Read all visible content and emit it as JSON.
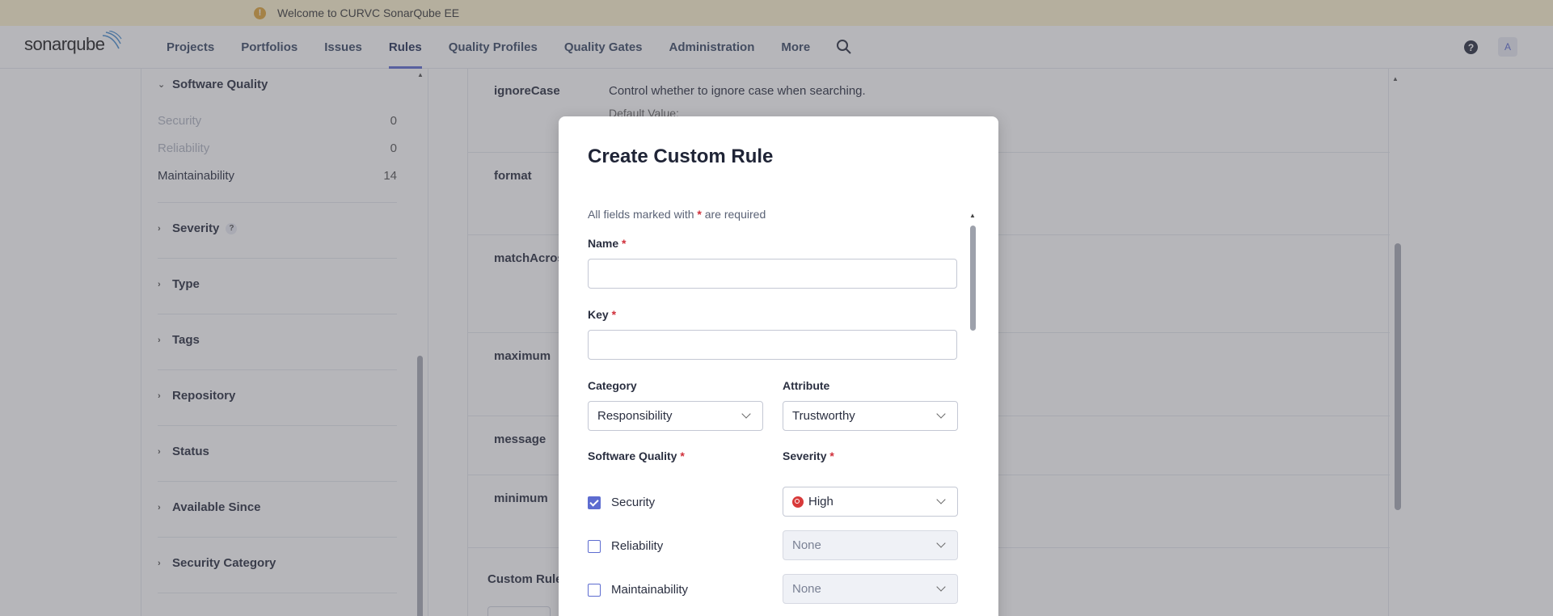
{
  "banner": {
    "text": "Welcome to CURVC SonarQube EE"
  },
  "navbar": {
    "logo_text": "sonarqube",
    "items": [
      {
        "label": "Projects"
      },
      {
        "label": "Portfolios"
      },
      {
        "label": "Issues"
      },
      {
        "label": "Rules",
        "active": true
      },
      {
        "label": "Quality Profiles"
      },
      {
        "label": "Quality Gates"
      },
      {
        "label": "Administration"
      },
      {
        "label": "More"
      }
    ],
    "avatar_letter": "A",
    "icons": [
      "search-icon",
      "help-icon"
    ]
  },
  "sidebar": {
    "software_quality": {
      "title": "Software Quality",
      "rows": [
        {
          "label": "Security",
          "count": "0"
        },
        {
          "label": "Reliability",
          "count": "0"
        },
        {
          "label": "Maintainability",
          "count": "14"
        }
      ]
    },
    "facets": [
      {
        "label": "Severity"
      },
      {
        "label": "Type"
      },
      {
        "label": "Tags"
      },
      {
        "label": "Repository"
      },
      {
        "label": "Status"
      },
      {
        "label": "Available Since"
      },
      {
        "label": "Security Category"
      }
    ]
  },
  "main": {
    "params": [
      {
        "key": "ignoreCase",
        "desc": "Control whether to ignore case when searching.",
        "sub": "Default Value:"
      },
      {
        "key": "format",
        "desc": ""
      },
      {
        "key": "matchAcros",
        "desc": ""
      },
      {
        "key": "maximum",
        "desc": ""
      },
      {
        "key": "message",
        "desc": ""
      },
      {
        "key": "minimum",
        "desc": ""
      }
    ],
    "custom_rules_label": "Custom Rules"
  },
  "modal": {
    "title": "Create Custom Rule",
    "required_note_prefix": "All fields marked with",
    "required_note_star": "*",
    "required_note_suffix": "are required",
    "name_label": "Name",
    "key_label": "Key",
    "name_value": "",
    "key_value": "",
    "category_label": "Category",
    "category_value": "Responsibility",
    "attribute_label": "Attribute",
    "attribute_value": "Trustworthy",
    "software_quality_label": "Software Quality",
    "severity_label": "Severity",
    "qualities": [
      {
        "label": "Security",
        "checked": true,
        "severity": "High"
      },
      {
        "label": "Reliability",
        "checked": false,
        "severity": "None"
      },
      {
        "label": "Maintainability",
        "checked": false,
        "severity": "None"
      }
    ],
    "colors": {
      "accent": "#5d6cd0",
      "required": "#d02f3a",
      "high_severity": "#d83a3a"
    }
  }
}
